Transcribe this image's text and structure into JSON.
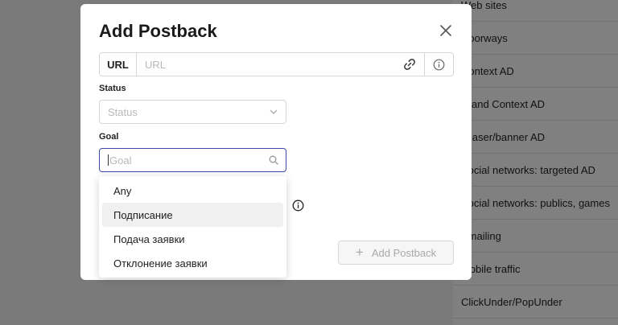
{
  "background_list": [
    "Web sites",
    "Doorways",
    "Context AD",
    "Brand Context AD",
    "Teaser/banner AD",
    "Social networks: targeted AD",
    "Social networks: publics, games",
    "Emailing",
    "Mobile traffic",
    "ClickUnder/PopUnder"
  ],
  "modal": {
    "title": "Add Postback",
    "url": {
      "addon_label": "URL",
      "placeholder": "URL",
      "value": ""
    },
    "status": {
      "label": "Status",
      "placeholder": "Status"
    },
    "goal": {
      "label": "Goal",
      "placeholder": "Goal"
    },
    "goal_options": [
      "Any",
      "Подписание",
      "Подача заявки",
      "Отклонение заявки"
    ],
    "goal_options_highlighted_index": 1,
    "add_button_label": "Add Postback"
  },
  "icons": {
    "close": "close-icon",
    "link": "link-icon",
    "info": "info-icon",
    "chevron": "chevron-down-icon",
    "search": "search-icon",
    "plus": "plus-icon"
  },
  "colors": {
    "focus_border": "#3b4aa8",
    "overlay": "rgba(0,0,0,0.45)"
  }
}
